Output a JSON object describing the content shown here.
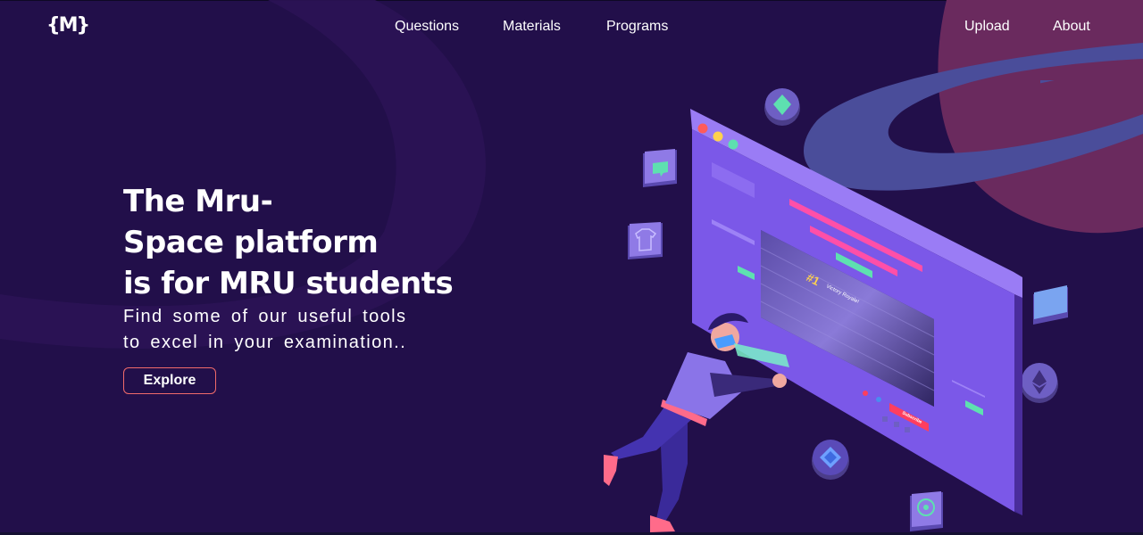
{
  "logo": {
    "text": "{M}"
  },
  "nav": {
    "center": [
      "Questions",
      "Materials",
      "Programs"
    ],
    "right": [
      "Upload",
      "About"
    ]
  },
  "hero": {
    "title_lines": [
      "The Mru-",
      "Space platform",
      "is for MRU students"
    ],
    "subtitle_lines": [
      "Find some of our useful tools",
      "to excel in your examination.."
    ],
    "cta_label": "Explore"
  },
  "illustration": {
    "screen_labels": {
      "rank": "#1",
      "banner": "Victory Royale!",
      "subscribe": "Subscribe"
    }
  },
  "colors": {
    "background": "#220f4a",
    "planet": "#6a2a5e",
    "ring": "#4a4d9a",
    "accent_button_border": "#f06a6a"
  }
}
